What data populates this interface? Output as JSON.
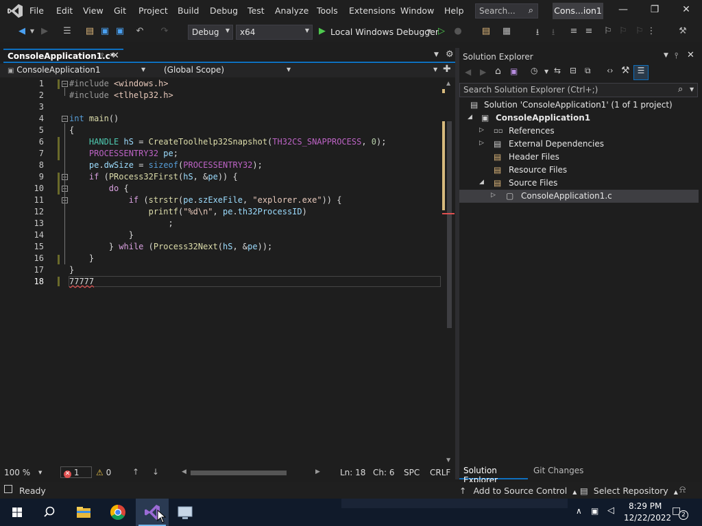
{
  "menu": [
    "File",
    "Edit",
    "View",
    "Git",
    "Project",
    "Build",
    "Debug",
    "Test",
    "Analyze",
    "Tools",
    "Extensions",
    "Window",
    "Help"
  ],
  "search_placeholder": "Search...",
  "solution_pill": "Cons...ion1",
  "toolbar": {
    "config": "Debug",
    "platform": "x64",
    "debugger": "Local Windows Debugger"
  },
  "tab": {
    "title": "ConsoleApplication1.c*"
  },
  "nav": {
    "project": "ConsoleApplication1",
    "scope": "(Global Scope)"
  },
  "editor": {
    "line_numbers": [
      "1",
      "2",
      "3",
      "4",
      "5",
      "6",
      "7",
      "8",
      "9",
      "10",
      "11",
      "12",
      "13",
      "14",
      "15",
      "16",
      "17",
      "18"
    ],
    "typed_text": "77777"
  },
  "status": {
    "zoom": "100 %",
    "errors": "1",
    "warnings": "0",
    "ln": "Ln: 18",
    "ch": "Ch: 6",
    "spc": "SPC",
    "crlf": "CRLF"
  },
  "solution_explorer": {
    "title": "Solution Explorer",
    "search_placeholder": "Search Solution Explorer (Ctrl+;)",
    "solution": "Solution 'ConsoleApplication1' (1 of 1 project)",
    "project": "ConsoleApplication1",
    "items": [
      "References",
      "External Dependencies",
      "Header Files",
      "Resource Files",
      "Source Files"
    ],
    "file": "ConsoleApplication1.c",
    "tabs": [
      "Solution Explorer",
      "Git Changes"
    ]
  },
  "bottom_bar": {
    "ready": "Ready",
    "add_source": "Add to Source Control",
    "select_repo": "Select Repository"
  },
  "taskbar": {
    "time": "8:29 PM",
    "date": "12/22/2022",
    "notifications": "2"
  }
}
